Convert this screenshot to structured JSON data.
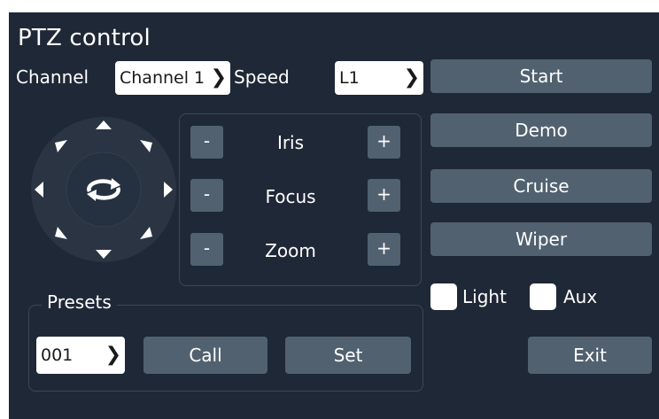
{
  "title": "PTZ control",
  "channel": {
    "label": "Channel",
    "value": "Channel 1"
  },
  "speed": {
    "label": "Speed",
    "value": "L1"
  },
  "controls": {
    "iris": {
      "minus": "-",
      "label": "Iris",
      "plus": "+"
    },
    "focus": {
      "minus": "-",
      "label": "Focus",
      "plus": "+"
    },
    "zoom": {
      "minus": "-",
      "label": "Zoom",
      "plus": "+"
    }
  },
  "right_buttons": {
    "start": "Start",
    "demo": "Demo",
    "cruise": "Cruise",
    "wiper": "Wiper"
  },
  "checkboxes": {
    "light": "Light",
    "aux": "Aux"
  },
  "presets": {
    "label": "Presets",
    "value": "001",
    "call": "Call",
    "set": "Set"
  },
  "exit": "Exit",
  "chevron": "❯",
  "colors": {
    "panel": "#1f2836",
    "button": "#516170",
    "joystick": "#2a3442",
    "arrow": "#ffffff"
  },
  "icons": [
    "arrow-up-icon",
    "arrow-down-icon",
    "arrow-left-icon",
    "arrow-right-icon",
    "arrow-up-left-icon",
    "arrow-up-right-icon",
    "arrow-down-left-icon",
    "arrow-down-right-icon",
    "rotate-icon",
    "chevron-right-icon"
  ]
}
